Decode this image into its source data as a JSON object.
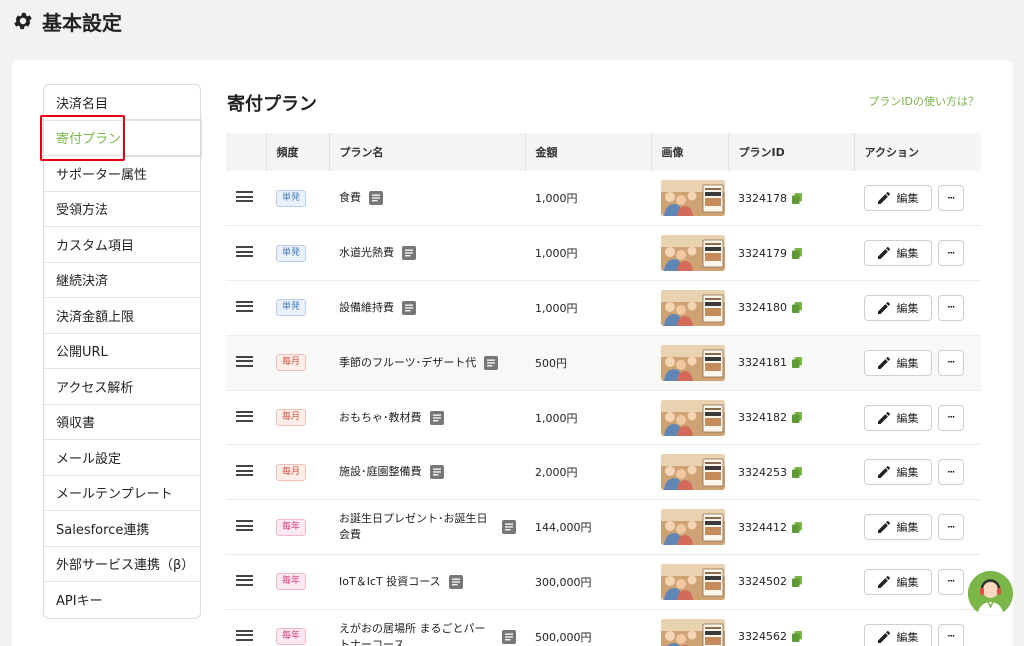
{
  "page": {
    "title": "基本設定"
  },
  "sidebar": {
    "items": [
      {
        "label": "決済名目"
      },
      {
        "label": "寄付プラン"
      },
      {
        "label": "サポーター属性"
      },
      {
        "label": "受領方法"
      },
      {
        "label": "カスタム項目"
      },
      {
        "label": "継続決済"
      },
      {
        "label": "決済金額上限"
      },
      {
        "label": "公開URL"
      },
      {
        "label": "アクセス解析"
      },
      {
        "label": "領収書"
      },
      {
        "label": "メール設定"
      },
      {
        "label": "メールテンプレート"
      },
      {
        "label": "Salesforce連携"
      },
      {
        "label": "外部サービス連携（β）"
      },
      {
        "label": "APIキー"
      }
    ],
    "active_index": 1
  },
  "section": {
    "title": "寄付プラン",
    "help_link": "プランIDの使い方は？"
  },
  "table": {
    "headers": {
      "frequency": "頻度",
      "name": "プラン名",
      "amount": "金額",
      "image": "画像",
      "plan_id": "プランID",
      "action": "アクション"
    },
    "edit_label": "編集",
    "more_label": "···",
    "rows": [
      {
        "frequency": "単発",
        "freq_type": "once",
        "name": "食費",
        "amount": "1,000円",
        "plan_id": "3324178"
      },
      {
        "frequency": "単発",
        "freq_type": "once",
        "name": "水道光熱費",
        "amount": "1,000円",
        "plan_id": "3324179"
      },
      {
        "frequency": "単発",
        "freq_type": "once",
        "name": "設備維持費",
        "amount": "1,000円",
        "plan_id": "3324180"
      },
      {
        "frequency": "毎月",
        "freq_type": "monthly",
        "name": "季節のフルーツ･デザート代",
        "amount": "500円",
        "plan_id": "3324181"
      },
      {
        "frequency": "毎月",
        "freq_type": "monthly",
        "name": "おもちゃ･教材費",
        "amount": "1,000円",
        "plan_id": "3324182"
      },
      {
        "frequency": "毎月",
        "freq_type": "monthly",
        "name": "施設･庭園整備費",
        "amount": "2,000円",
        "plan_id": "3324253"
      },
      {
        "frequency": "毎年",
        "freq_type": "yearly",
        "name": "お誕生日プレゼント･お誕生日会費",
        "amount": "144,000円",
        "plan_id": "3324412"
      },
      {
        "frequency": "毎年",
        "freq_type": "yearly",
        "name": "IoT＆IcT 投資コース",
        "amount": "300,000円",
        "plan_id": "3324502"
      },
      {
        "frequency": "毎年",
        "freq_type": "yearly",
        "name": "えがおの居場所 まるごとパートナーコース",
        "amount": "500,000円",
        "plan_id": "3324562"
      }
    ]
  },
  "colors": {
    "accent": "#7ab648",
    "highlight": "#e60012"
  },
  "icons": {
    "header": "gear-icon",
    "drag": "drag-handle-icon",
    "note": "document-icon",
    "copy": "copy-icon",
    "edit": "pencil-icon",
    "support": "support-avatar-icon"
  }
}
